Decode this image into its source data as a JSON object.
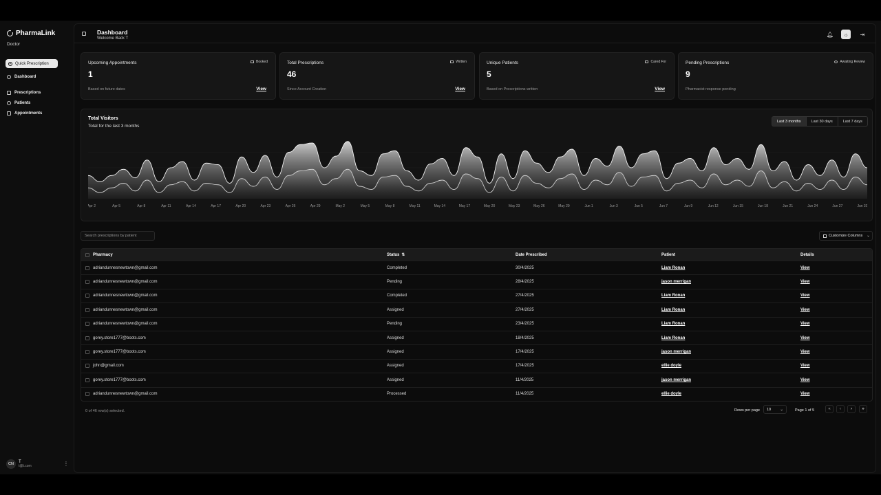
{
  "sidebar": {
    "brand": "PharmaLink",
    "role": "Doctor",
    "quick_label": "Quick Prescription",
    "items": [
      {
        "label": "Dashboard"
      },
      {
        "label": "Prescriptions"
      },
      {
        "label": "Patients"
      },
      {
        "label": "Appointments"
      }
    ],
    "user": {
      "initials": "CN",
      "name": "T",
      "email": "t@t.com"
    }
  },
  "header": {
    "title": "Dashboard",
    "welcome": "Welcome Back T"
  },
  "cards": [
    {
      "title": "Upcoming Appointments",
      "badge": "Booked",
      "value": "1",
      "desc": "Based on future dates",
      "link": "View"
    },
    {
      "title": "Total Prescriptions",
      "badge": "Written",
      "value": "46",
      "desc": "Since Account Creation",
      "link": "View"
    },
    {
      "title": "Unique Patients",
      "badge": "Cared For",
      "value": "5",
      "desc": "Based on Prescriptions written",
      "link": "View"
    },
    {
      "title": "Pending Prescriptions",
      "badge": "Awaiting Review",
      "value": "9",
      "desc": "Pharmacist response pending",
      "link": ""
    }
  ],
  "chart": {
    "title": "Total Visitors",
    "subtitle": "Total for the last 3 months",
    "ranges": [
      "Last 3 months",
      "Last 30 days",
      "Last 7 days"
    ],
    "active_range": "Last 3 months"
  },
  "chart_data": {
    "type": "area",
    "title": "Total Visitors",
    "xlabel": "",
    "ylabel": "",
    "x_ticks": [
      "Apr 2",
      "Apr 5",
      "Apr 8",
      "Apr 11",
      "Apr 14",
      "Apr 17",
      "Apr 20",
      "Apr 23",
      "Apr 26",
      "Apr 29",
      "May 2",
      "May 5",
      "May 8",
      "May 11",
      "May 14",
      "May 17",
      "May 20",
      "May 23",
      "May 26",
      "May 29",
      "Jun 1",
      "Jun 3",
      "Jun 5",
      "Jun 7",
      "Jun 9",
      "Jun 12",
      "Jun 15",
      "Jun 18",
      "Jun 21",
      "Jun 24",
      "Jun 27",
      "Jun 30"
    ],
    "series": [
      {
        "values": [
          30,
          22,
          30,
          38,
          27,
          50,
          22,
          40,
          48,
          24,
          46,
          44,
          20,
          54,
          34,
          56,
          28,
          60,
          70,
          72,
          40,
          55,
          74,
          36,
          30,
          58,
          62,
          36,
          24,
          45,
          52,
          30,
          66,
          54,
          20,
          58,
          26,
          62,
          46,
          34,
          54,
          64,
          30,
          52,
          42,
          68,
          40,
          58,
          62,
          26,
          46,
          52,
          36,
          66,
          44,
          52,
          38,
          70,
          36,
          48,
          24,
          44,
          30,
          50,
          28,
          58,
          40
        ]
      },
      {
        "values": [
          14,
          8,
          14,
          20,
          10,
          24,
          8,
          18,
          22,
          10,
          20,
          18,
          8,
          26,
          16,
          28,
          12,
          30,
          36,
          38,
          18,
          26,
          38,
          16,
          12,
          28,
          30,
          16,
          10,
          20,
          24,
          12,
          32,
          26,
          8,
          28,
          10,
          30,
          20,
          14,
          26,
          32,
          12,
          24,
          18,
          34,
          16,
          28,
          30,
          10,
          20,
          24,
          14,
          32,
          18,
          24,
          16,
          36,
          14,
          22,
          10,
          20,
          12,
          24,
          12,
          28,
          18
        ]
      }
    ],
    "ylim": [
      0,
      80
    ],
    "grid": true
  },
  "table": {
    "search_placeholder": "Search prescriptions by patient",
    "customize_label": "Customize Columns",
    "columns": [
      "Pharmacy",
      "Status",
      "Date Prescribed",
      "Patient",
      "Details"
    ],
    "rows": [
      {
        "pharmacy": "adriandunnesnewtown@gmail.com",
        "status": "Completed",
        "date": "30/4/2025",
        "patient": "Liam Ronan",
        "details": "View"
      },
      {
        "pharmacy": "adriandunnesnewtown@gmail.com",
        "status": "Pending",
        "date": "28/4/2025",
        "patient": "jason merrigan",
        "details": "View"
      },
      {
        "pharmacy": "adriandunnesnewtown@gmail.com",
        "status": "Completed",
        "date": "27/4/2025",
        "patient": "Liam Ronan",
        "details": "View"
      },
      {
        "pharmacy": "adriandunnesnewtown@gmail.com",
        "status": "Assigned",
        "date": "27/4/2025",
        "patient": "Liam Ronan",
        "details": "View"
      },
      {
        "pharmacy": "adriandunnesnewtown@gmail.com",
        "status": "Pending",
        "date": "23/4/2025",
        "patient": "Liam Ronan",
        "details": "View"
      },
      {
        "pharmacy": "gorey.store1777@boots.com",
        "status": "Assigned",
        "date": "18/4/2025",
        "patient": "Liam Ronan",
        "details": "View"
      },
      {
        "pharmacy": "gorey.store1777@boots.com",
        "status": "Assigned",
        "date": "17/4/2025",
        "patient": "jason merrigan",
        "details": "View"
      },
      {
        "pharmacy": "john@gmail.com",
        "status": "Assigned",
        "date": "17/4/2025",
        "patient": "ellie doyle",
        "details": "View"
      },
      {
        "pharmacy": "gorey.store1777@boots.com",
        "status": "Assigned",
        "date": "11/4/2025",
        "patient": "jason merrigan",
        "details": "View"
      },
      {
        "pharmacy": "adriandunnesnewtown@gmail.com",
        "status": "Processed",
        "date": "11/4/2025",
        "patient": "ellie doyle",
        "details": "View"
      }
    ],
    "selection_text": "0 of 46 row(s) selected.",
    "rows_per_page_label": "Rows per page",
    "rows_per_page_value": "10",
    "page_info": "Page 1 of 5"
  }
}
